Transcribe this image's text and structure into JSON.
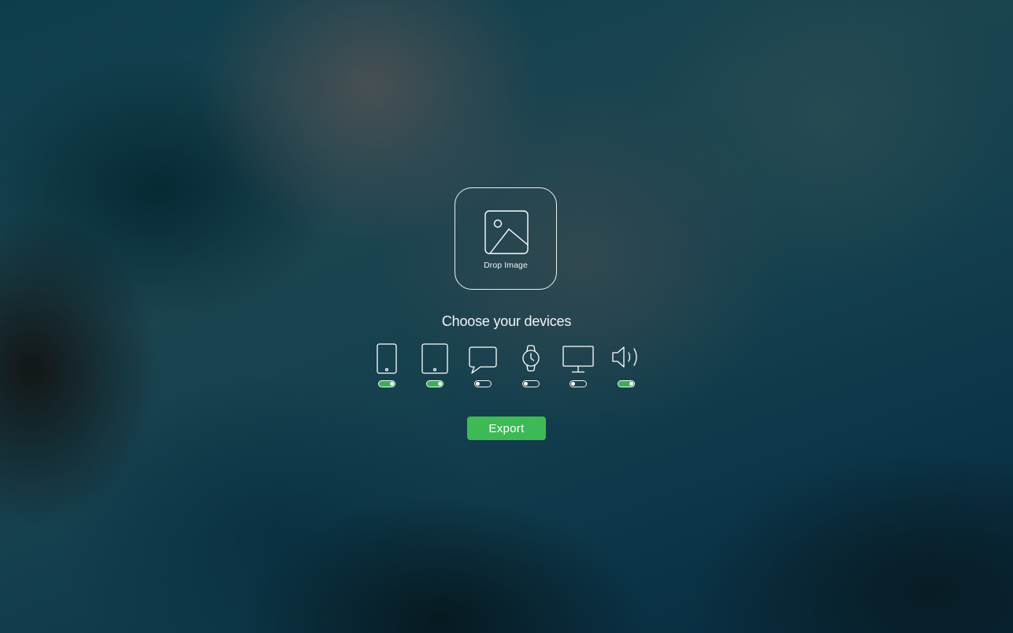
{
  "drop_zone": {
    "label": "Drop Image",
    "icon": "image-icon"
  },
  "heading": "Choose your devices",
  "devices": [
    {
      "id": "phone",
      "icon": "phone-icon",
      "enabled": true
    },
    {
      "id": "tablet",
      "icon": "tablet-icon",
      "enabled": true
    },
    {
      "id": "messages",
      "icon": "chat-bubble-icon",
      "enabled": false
    },
    {
      "id": "watch",
      "icon": "watch-icon",
      "enabled": false
    },
    {
      "id": "desktop",
      "icon": "monitor-icon",
      "enabled": false
    },
    {
      "id": "audio",
      "icon": "speaker-icon",
      "enabled": true
    }
  ],
  "export_button": {
    "label": "Export"
  },
  "colors": {
    "accent": "#3dba55",
    "toggle_on": "#34b255",
    "foreground": "#ffffff"
  }
}
